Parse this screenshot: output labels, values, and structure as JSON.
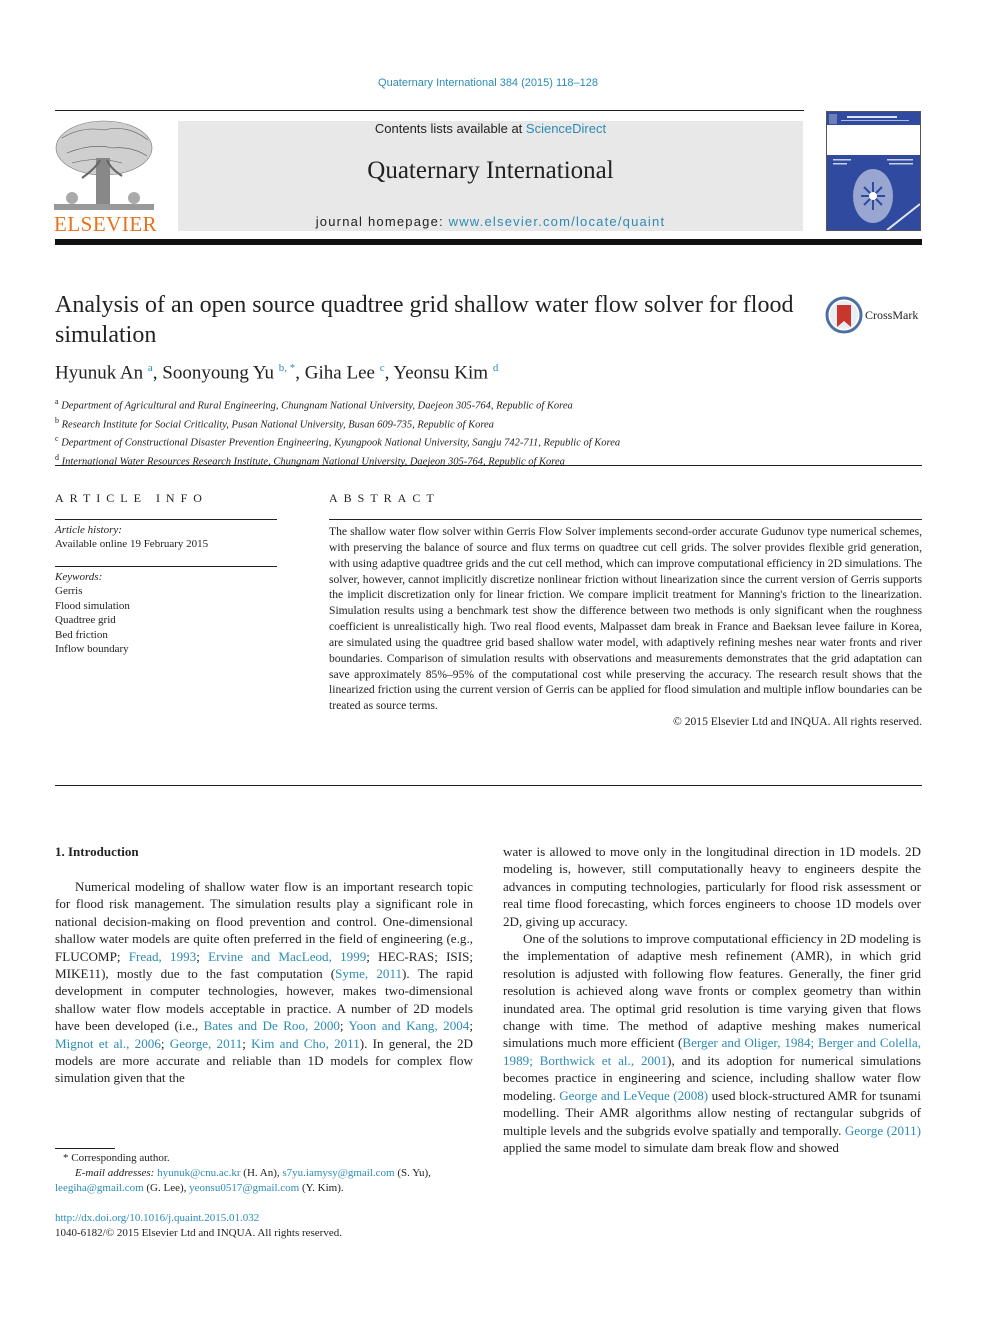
{
  "header": {
    "citation": "Quaternary International 384 (2015) 118–128",
    "contents_prefix": "Contents lists available at ",
    "contents_link": "ScienceDirect",
    "journal_title": "Quaternary International",
    "homepage_prefix": "journal homepage: ",
    "homepage_link": "www.elsevier.com/locate/quaint",
    "publisher_logo": "ELSEVIER",
    "crossmark_label": "CrossMark",
    "colors": {
      "link": "#2c8bb5",
      "elsevier_orange": "#e9711c",
      "cover_blue": "#2f4a9e",
      "banner_gray": "#e8e8e8"
    }
  },
  "article": {
    "title": "Analysis of an open source quadtree grid shallow water flow solver for flood simulation",
    "authors": [
      {
        "name": "Hyunuk An",
        "sup": "a"
      },
      {
        "name": "Soonyoung Yu",
        "sup": "b, *"
      },
      {
        "name": "Giha Lee",
        "sup": "c"
      },
      {
        "name": "Yeonsu Kim",
        "sup": "d"
      }
    ],
    "affiliations": [
      {
        "sup": "a",
        "text": "Department of Agricultural and Rural Engineering, Chungnam National University, Daejeon 305-764, Republic of Korea"
      },
      {
        "sup": "b",
        "text": "Research Institute for Social Criticality, Pusan National University, Busan 609-735, Republic of Korea"
      },
      {
        "sup": "c",
        "text": "Department of Constructional Disaster Prevention Engineering, Kyungpook National University, Sangju 742-711, Republic of Korea"
      },
      {
        "sup": "d",
        "text": "International Water Resources Research Institute, Chungnam National University, Daejeon 305-764, Republic of Korea"
      }
    ]
  },
  "article_info": {
    "heading": "ARTICLE INFO",
    "history_label": "Article history:",
    "history_value": "Available online 19 February 2015",
    "keywords_label": "Keywords:",
    "keywords": [
      "Gerris",
      "Flood simulation",
      "Quadtree grid",
      "Bed friction",
      "Inflow boundary"
    ]
  },
  "abstract": {
    "heading": "ABSTRACT",
    "text": "The shallow water flow solver within Gerris Flow Solver implements second-order accurate Gudunov type numerical schemes, with preserving the balance of source and flux terms on quadtree cut cell grids. The solver provides flexible grid generation, with using adaptive quadtree grids and the cut cell method, which can improve computational efficiency in 2D simulations. The solver, however, cannot implicitly discretize nonlinear friction without linearization since the current version of Gerris supports the implicit discretization only for linear friction. We compare implicit treatment for Manning's friction to the linearization. Simulation results using a benchmark test show the difference between two methods is only significant when the roughness coefficient is unrealistically high. Two real flood events, Malpasset dam break in France and Baeksan levee failure in Korea, are simulated using the quadtree grid based shallow water model, with adaptively refining meshes near water fronts and river boundaries. Comparison of simulation results with observations and measurements demonstrates that the grid adaptation can save approximately 85%–95% of the computational cost while preserving the accuracy. The research result shows that the linearized friction using the current version of Gerris can be applied for flood simulation and multiple inflow boundaries can be treated as source terms.",
    "copyright": "© 2015 Elsevier Ltd and INQUA. All rights reserved."
  },
  "body": {
    "section_heading": "1.  Introduction",
    "col1": [
      {
        "t": "Numerical modeling of shallow water flow is an important research topic for flood risk management. The simulation results play a significant role in national decision-making on flood prevention and control. One-dimensional shallow water models are quite often preferred in the field of engineering (e.g., FLUCOMP; "
      },
      {
        "l": "Fread, 1993"
      },
      {
        "t": "; "
      },
      {
        "l": "Ervine and MacLeod, 1999"
      },
      {
        "t": "; HEC-RAS; ISIS; MIKE11), mostly due to the fast computation ("
      },
      {
        "l": "Syme, 2011"
      },
      {
        "t": "). The rapid development in computer technologies, however, makes two-dimensional shallow water flow models acceptable in practice. A number of 2D models have been developed (i.e., "
      },
      {
        "l": "Bates and De Roo, 2000"
      },
      {
        "t": "; "
      },
      {
        "l": "Yoon and Kang, 2004"
      },
      {
        "t": "; "
      },
      {
        "l": "Mignot et al., 2006"
      },
      {
        "t": "; "
      },
      {
        "l": "George, 2011"
      },
      {
        "t": "; "
      },
      {
        "l": "Kim and Cho, 2011"
      },
      {
        "t": "). In general, the 2D models are more accurate and reliable than 1D models for complex flow simulation given that the"
      }
    ],
    "col2_p1": [
      {
        "t": "water is allowed to move only in the longitudinal direction in 1D models. 2D modeling is, however, still computationally heavy to engineers despite the advances in computing technologies, particularly for flood risk assessment or real time flood forecasting, which forces engineers to choose 1D models over 2D, giving up accuracy."
      }
    ],
    "col2_p2": [
      {
        "t": "One of the solutions to improve computational efficiency in 2D modeling is the implementation of adaptive mesh refinement (AMR), in which grid resolution is adjusted with following flow features. Generally, the finer grid resolution is achieved along wave fronts or complex geometry than within inundated area. The optimal grid resolution is time varying given that flows change with time. The method of adaptive meshing makes numerical simulations much more efficient ("
      },
      {
        "l": "Berger and Oliger, 1984; Berger and Colella, 1989; Borthwick et al., 2001"
      },
      {
        "t": "), and its adoption for numerical simulations becomes practice in engineering and science, including shallow water flow modeling. "
      },
      {
        "l": "George and LeVeque (2008)"
      },
      {
        "t": " used block-structured AMR for tsunami modelling. Their AMR algorithms allow nesting of rectangular subgrids of multiple levels and the subgrids evolve spatially and temporally. "
      },
      {
        "l": "George (2011)"
      },
      {
        "t": " applied the same model to simulate dam break flow and showed"
      }
    ]
  },
  "footnotes": {
    "corresponding": "* Corresponding author.",
    "email_label": "E-mail addresses:",
    "emails": [
      {
        "addr": "hyunuk@cnu.ac.kr",
        "who": " (H. An), "
      },
      {
        "addr": "s7yu.iamysy@gmail.com",
        "who": " (S. Yu), "
      },
      {
        "addr": "leegiha@gmail.com",
        "who": " (G. Lee), "
      },
      {
        "addr": "yeonsu0517@gmail.com",
        "who": " (Y. Kim)."
      }
    ],
    "doi": "http://dx.doi.org/10.1016/j.quaint.2015.01.032",
    "issn_copyright": "1040-6182/© 2015 Elsevier Ltd and INQUA. All rights reserved."
  }
}
